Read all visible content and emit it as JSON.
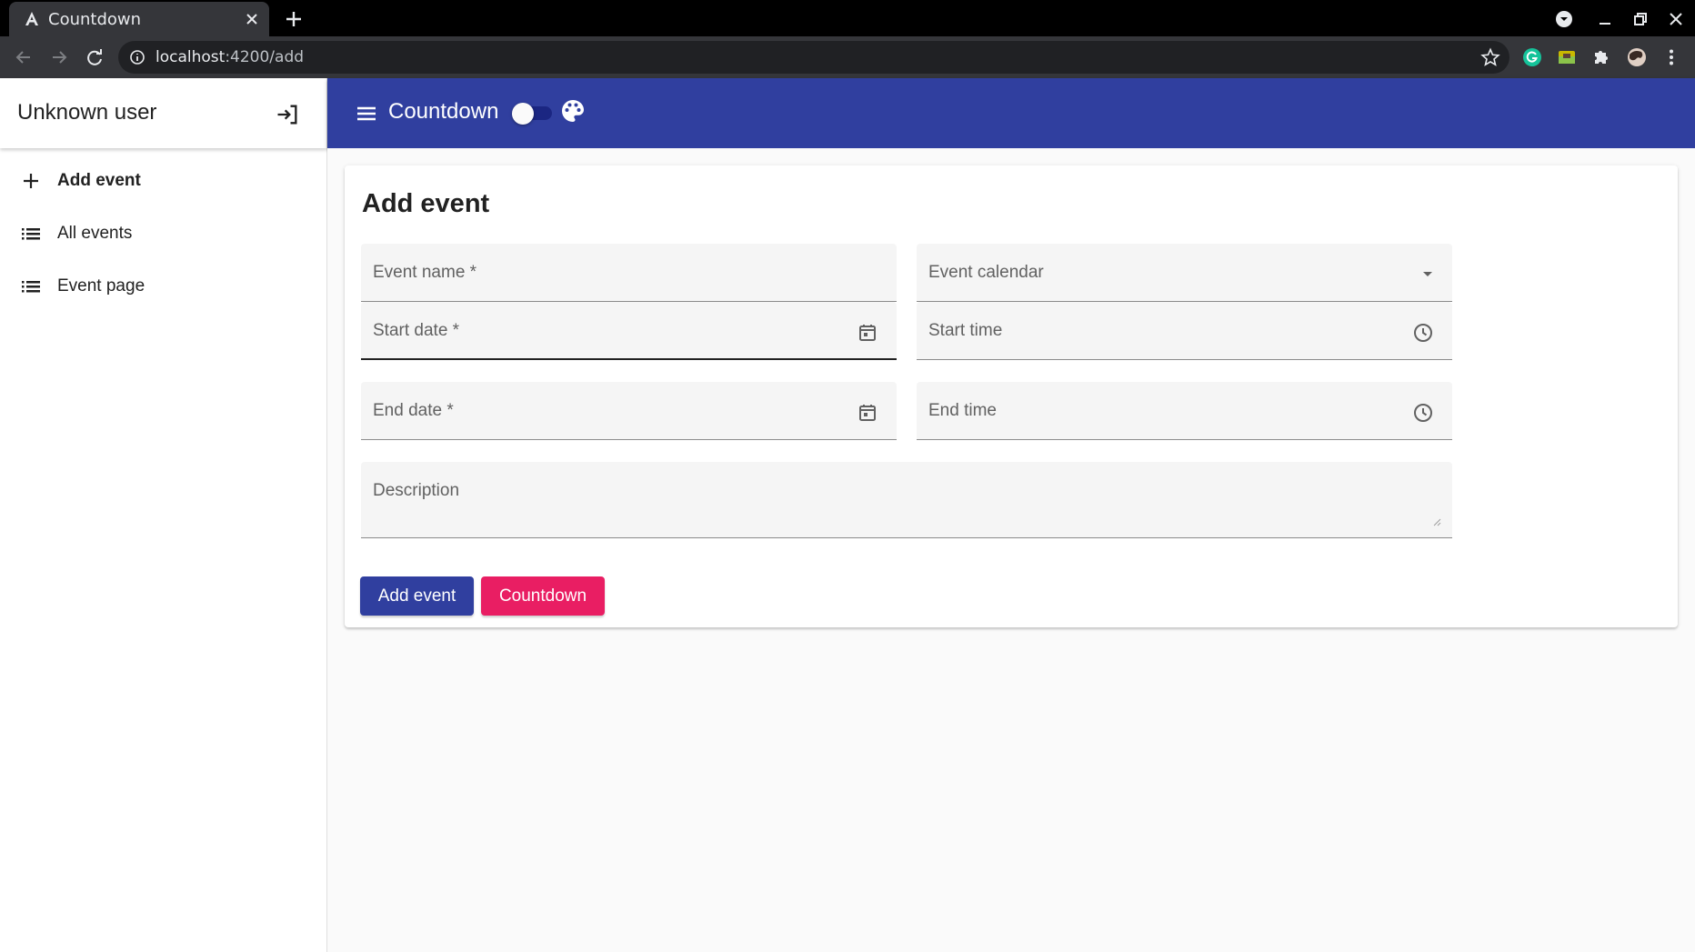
{
  "browser": {
    "tab_title": "Countdown",
    "url_host": "localhost",
    "url_path": ":4200/add"
  },
  "sidenav": {
    "user_label": "Unknown user",
    "items": [
      {
        "label": "Add event",
        "icon": "plus-icon",
        "active": true
      },
      {
        "label": "All events",
        "icon": "list-icon",
        "active": false
      },
      {
        "label": "Event page",
        "icon": "list-icon",
        "active": false
      }
    ]
  },
  "appbar": {
    "title": "Countdown",
    "theme_toggle_on": false
  },
  "form": {
    "title": "Add event",
    "fields": {
      "event_name": "Event name *",
      "event_calendar": "Event calendar",
      "start_date": "Start date *",
      "start_time": "Start time",
      "end_date": "End date *",
      "end_time": "End time",
      "description": "Description"
    },
    "buttons": {
      "add_event": "Add event",
      "countdown": "Countdown"
    }
  },
  "colors": {
    "primary": "#303f9f",
    "accent": "#e91e63"
  }
}
